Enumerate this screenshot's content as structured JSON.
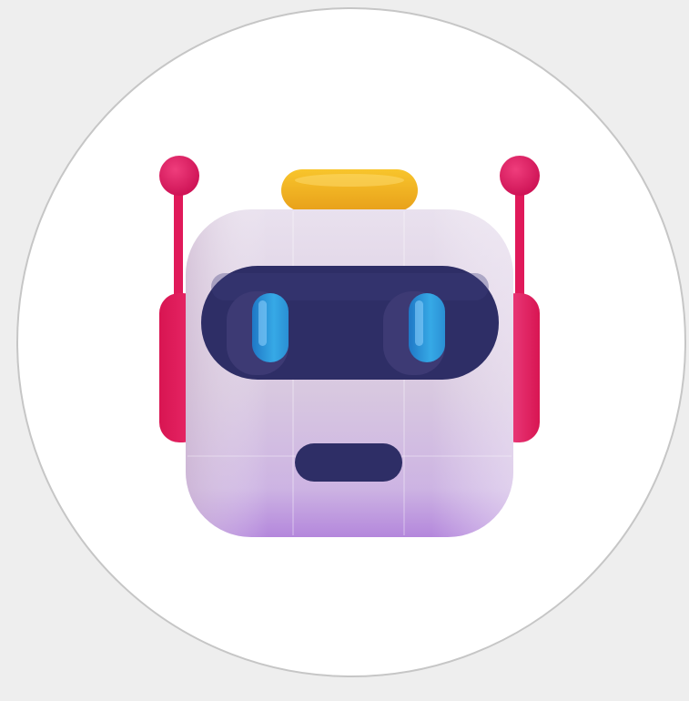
{
  "avatar": {
    "icon": "robot-icon",
    "colors": {
      "background": "#eeeeee",
      "circle_fill": "#ffffff",
      "circle_border": "#c6c6c6",
      "head_light": "#ece4f1",
      "head_mid": "#d5c4df",
      "head_bottom": "#b48ad8",
      "visor": "#2e2e66",
      "eye": "#2d9cdb",
      "antenna": "#e0195a",
      "hat": "#f2b21e",
      "mouth": "#2e2e66"
    }
  }
}
